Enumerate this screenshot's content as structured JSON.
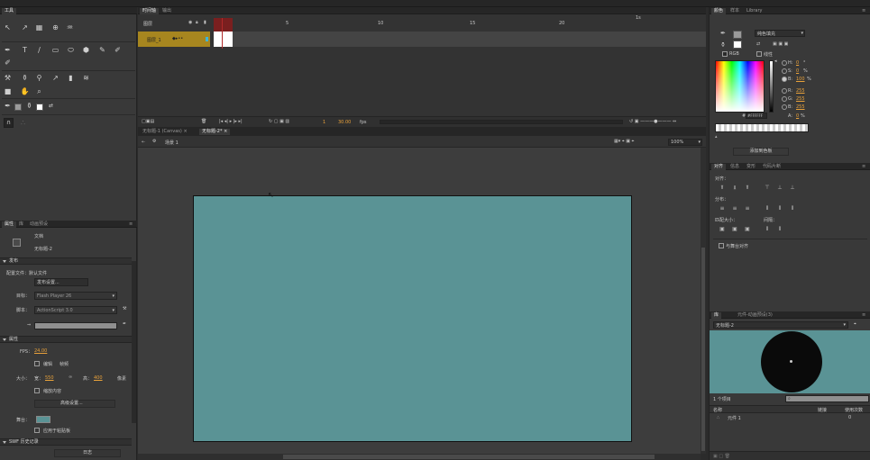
{
  "tools_panel": {
    "title": "工具"
  },
  "timeline": {
    "tabs": [
      {
        "label": "时间轴"
      },
      {
        "label": "输出"
      }
    ],
    "layer_header": "图层",
    "layer_name": "图层_1",
    "frame_ticks": [
      "1",
      "5",
      "10",
      "15",
      "20"
    ],
    "fps_right": "1s",
    "current_frame": "1",
    "fps_value": "30.00",
    "fps_unit": "fps"
  },
  "document_tabs": [
    {
      "label": "无标题-1 (Canvas)"
    },
    {
      "label": "无标题-2*"
    }
  ],
  "stage_bar": {
    "scene": "场景 1",
    "zoom": "100%"
  },
  "stage": {
    "background_color": "#5a9395"
  },
  "properties_panel": {
    "tabs": [
      {
        "label": "属性"
      },
      {
        "label": "库"
      },
      {
        "label": "动画预设"
      }
    ],
    "doc_type": "文档",
    "doc_name": "无标题-2",
    "section_publish": "发布",
    "profile_label": "配置文件：默认文件",
    "publish_settings_btn": "发布设置...",
    "target_label": "目标：",
    "target_value": "Flash Player 26",
    "script_label": "脚本：",
    "script_value": "ActionScript 3.0",
    "section_props": "属性",
    "fps_label": "FPS：",
    "fps_value": "24.00",
    "size_label": "大小：",
    "width_label": "宽：",
    "width_value": "550",
    "height_label": "高：",
    "height_value": "400",
    "unit": "像素",
    "scale_content": "缩放内容",
    "advanced_btn": "高级设置...",
    "stage_label": "舞台：",
    "apply_pasteboard": "应用于粘贴板",
    "section_swf": "SWF 历史记录",
    "log_btn": "日志",
    "edit_checkbox": "编辑",
    "fps_checkbox_label": "帧频"
  },
  "color_panel": {
    "tabs": [
      {
        "label": "颜色"
      },
      {
        "label": "样本"
      },
      {
        "label": "Library"
      }
    ],
    "fill_type": "纯色填充",
    "rgb_label": "RGB",
    "linear_label": "线性",
    "hsb": [
      {
        "label": "H:",
        "value": "0"
      },
      {
        "label": "S:",
        "value": "0"
      },
      {
        "label": "B:",
        "value": "100"
      }
    ],
    "hsb_units": [
      "°",
      "%",
      "%"
    ],
    "rgb": [
      {
        "label": "R:",
        "value": "255"
      },
      {
        "label": "G:",
        "value": "255"
      },
      {
        "label": "B:",
        "value": "255"
      }
    ],
    "alpha": {
      "label": "A:",
      "value": "0"
    },
    "alpha_unit": "%",
    "hex": "#FFFFFF",
    "add_swatch": "添加到色板"
  },
  "align_panel": {
    "tabs": [
      {
        "label": "对齐"
      },
      {
        "label": "信息"
      },
      {
        "label": "变形"
      },
      {
        "label": "代码片断"
      }
    ],
    "align_label": "对齐：",
    "distribute_label": "分布：",
    "match_size_label": "匹配大小：",
    "spacing_label": "间隔：",
    "to_stage": "与舞台对齐"
  },
  "library_panel": {
    "tabs": [
      {
        "label": "库"
      },
      {
        "label": "元件-动画预设(3)"
      }
    ],
    "selected_doc": "无标题-2",
    "item_count": "1 个项目",
    "col_name": "名称",
    "col_linkage": "链接",
    "col_uses": "使用次数",
    "item_name": "元件 1",
    "item_uses": "0"
  }
}
